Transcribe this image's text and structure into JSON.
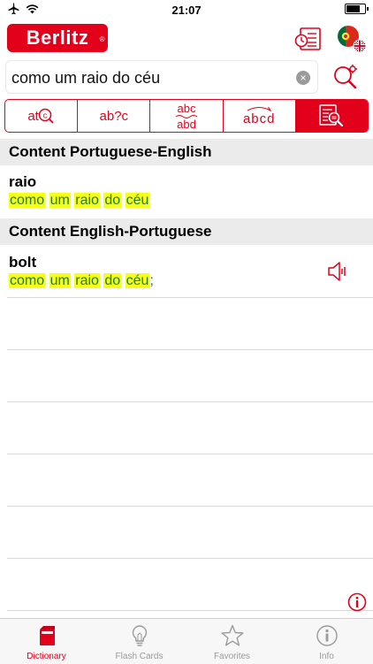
{
  "status_bar": {
    "time": "21:07"
  },
  "header": {
    "logo_text": "Berlitz",
    "logo_mark": "®"
  },
  "search": {
    "value": "como um raio do céu",
    "clear": "×"
  },
  "modes": [
    {
      "label": "at",
      "icon": "spell-search-icon"
    },
    {
      "label": "ab?c",
      "icon": "wildcard-icon"
    },
    {
      "label_top": "abc",
      "label_bottom": "abd",
      "icon": "fuzzy-icon"
    },
    {
      "label": "abcd",
      "icon": "anagram-icon"
    },
    {
      "icon": "fulltext-search-icon",
      "active": true
    }
  ],
  "sections": [
    {
      "title": "Content Portuguese-English",
      "entries": [
        {
          "word": "raio",
          "phrase": [
            "como",
            "um",
            "raio",
            "do",
            "céu"
          ]
        }
      ]
    },
    {
      "title": "Content English-Portuguese",
      "entries": [
        {
          "word": "bolt",
          "phrase": [
            "como",
            "um",
            "raio",
            "do",
            "céu"
          ],
          "suffix": ";"
        }
      ]
    }
  ],
  "tabbar": [
    {
      "label": "Dictionary",
      "icon": "book-icon",
      "active": true
    },
    {
      "label": "Flash Cards",
      "icon": "lightbulb-icon"
    },
    {
      "label": "Favorites",
      "icon": "star-icon"
    },
    {
      "label": "Info",
      "icon": "info-icon"
    }
  ],
  "colors": {
    "accent": "#e2001a",
    "highlight": "#f5ff1a",
    "match_text": "#247a3a"
  }
}
